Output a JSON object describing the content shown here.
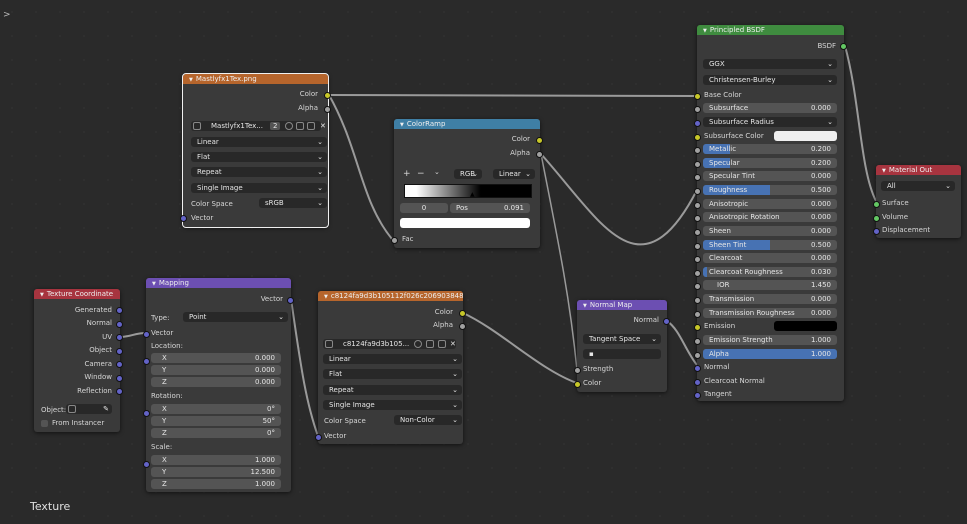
{
  "texture_node": {
    "title": "Mastlyfx1Tex.png",
    "out_color": "Color",
    "out_alpha": "Alpha",
    "image_name": "Mastlyfx1Tex...",
    "users": "2",
    "interpolation": "Linear",
    "projection": "Flat",
    "extension": "Repeat",
    "source": "Single Image",
    "color_space_label": "Color Space",
    "color_space": "sRGB",
    "in_vector": "Vector"
  },
  "colorramp_node": {
    "title": "ColorRamp",
    "out_color": "Color",
    "out_alpha": "Alpha",
    "add": "+",
    "remove": "−",
    "mode": "RGB",
    "interp": "Linear",
    "index": "0",
    "pos_label": "Pos",
    "pos_value": "0.091",
    "in_fac": "Fac"
  },
  "texcoord_node": {
    "title": "Texture Coordinate",
    "outputs": [
      "Generated",
      "Normal",
      "UV",
      "Object",
      "Camera",
      "Window",
      "Reflection"
    ],
    "object_label": "Object:",
    "from_instancer": "From Instancer"
  },
  "mapping_node": {
    "title": "Mapping",
    "out_vector": "Vector",
    "type_label": "Type:",
    "type_value": "Point",
    "in_vector": "Vector",
    "location_label": "Location:",
    "location": [
      {
        "axis": "X",
        "value": "0.000"
      },
      {
        "axis": "Y",
        "value": "0.000"
      },
      {
        "axis": "Z",
        "value": "0.000"
      }
    ],
    "rotation_label": "Rotation:",
    "rotation": [
      {
        "axis": "X",
        "value": "0°"
      },
      {
        "axis": "Y",
        "value": "50°"
      },
      {
        "axis": "Z",
        "value": "0°"
      }
    ],
    "scale_label": "Scale:",
    "scale": [
      {
        "axis": "X",
        "value": "1.000"
      },
      {
        "axis": "Y",
        "value": "12.500"
      },
      {
        "axis": "Z",
        "value": "1.000"
      }
    ]
  },
  "normaltex_node": {
    "title": "c8124fa9d3b105112f026c206903848a.j...",
    "out_color": "Color",
    "out_alpha": "Alpha",
    "image_name": "c8124fa9d3b105...",
    "interpolation": "Linear",
    "projection": "Flat",
    "extension": "Repeat",
    "source": "Single Image",
    "color_space_label": "Color Space",
    "color_space": "Non-Color",
    "in_vector": "Vector"
  },
  "normalmap_node": {
    "title": "Normal Map",
    "out_normal": "Normal",
    "space": "Tangent Space",
    "uv_map": "",
    "in_strength": "Strength",
    "in_color": "Color"
  },
  "bsdf_node": {
    "title": "Principled BSDF",
    "out_bsdf": "BSDF",
    "distribution": "GGX",
    "subsurface_method": "Christensen-Burley",
    "base_color": "Base Color",
    "subsurface": {
      "label": "Subsurface",
      "value": "0.000"
    },
    "subsurface_radius": "Subsurface Radius",
    "subsurface_color": "Subsurface Color",
    "metallic": {
      "label": "Metallic",
      "value": "0.200",
      "fill": 0.2
    },
    "specular": {
      "label": "Specular",
      "value": "0.200",
      "fill": 0.2
    },
    "specular_tint": {
      "label": "Specular Tint",
      "value": "0.000"
    },
    "roughness": {
      "label": "Roughness",
      "value": "0.500",
      "fill": 0.5
    },
    "anisotropic": {
      "label": "Anisotropic",
      "value": "0.000"
    },
    "anisotropic_rotation": {
      "label": "Anisotropic Rotation",
      "value": "0.000"
    },
    "sheen": {
      "label": "Sheen",
      "value": "0.000"
    },
    "sheen_tint": {
      "label": "Sheen Tint",
      "value": "0.500",
      "fill": 0.5
    },
    "clearcoat": {
      "label": "Clearcoat",
      "value": "0.000"
    },
    "clearcoat_roughness": {
      "label": "Clearcoat Roughness",
      "value": "0.030",
      "fill": 0.03
    },
    "ior": {
      "label": "IOR",
      "value": "1.450"
    },
    "transmission": {
      "label": "Transmission",
      "value": "0.000"
    },
    "transmission_roughness": {
      "label": "Transmission Roughness",
      "value": "0.000"
    },
    "emission": "Emission",
    "emission_strength": {
      "label": "Emission Strength",
      "value": "1.000"
    },
    "alpha": {
      "label": "Alpha",
      "value": "1.000",
      "fill": 1.0
    },
    "in_normal": "Normal",
    "in_clearcoat_normal": "Clearcoat Normal",
    "in_tangent": "Tangent"
  },
  "output_node": {
    "title": "Material Out",
    "target": "All",
    "in_surface": "Surface",
    "in_volume": "Volume",
    "in_displacement": "Displacement"
  },
  "editor": {
    "label": "Texture",
    "sidebar_toggle": ">"
  },
  "colors": {
    "texture_header": "#b6652c",
    "converter_header": "#3f7fa5",
    "vector_header": "#6c4fb2",
    "input_header": "#a7343f",
    "shader_header": "#3f8c3f",
    "accent_blue": "#4772b3"
  }
}
